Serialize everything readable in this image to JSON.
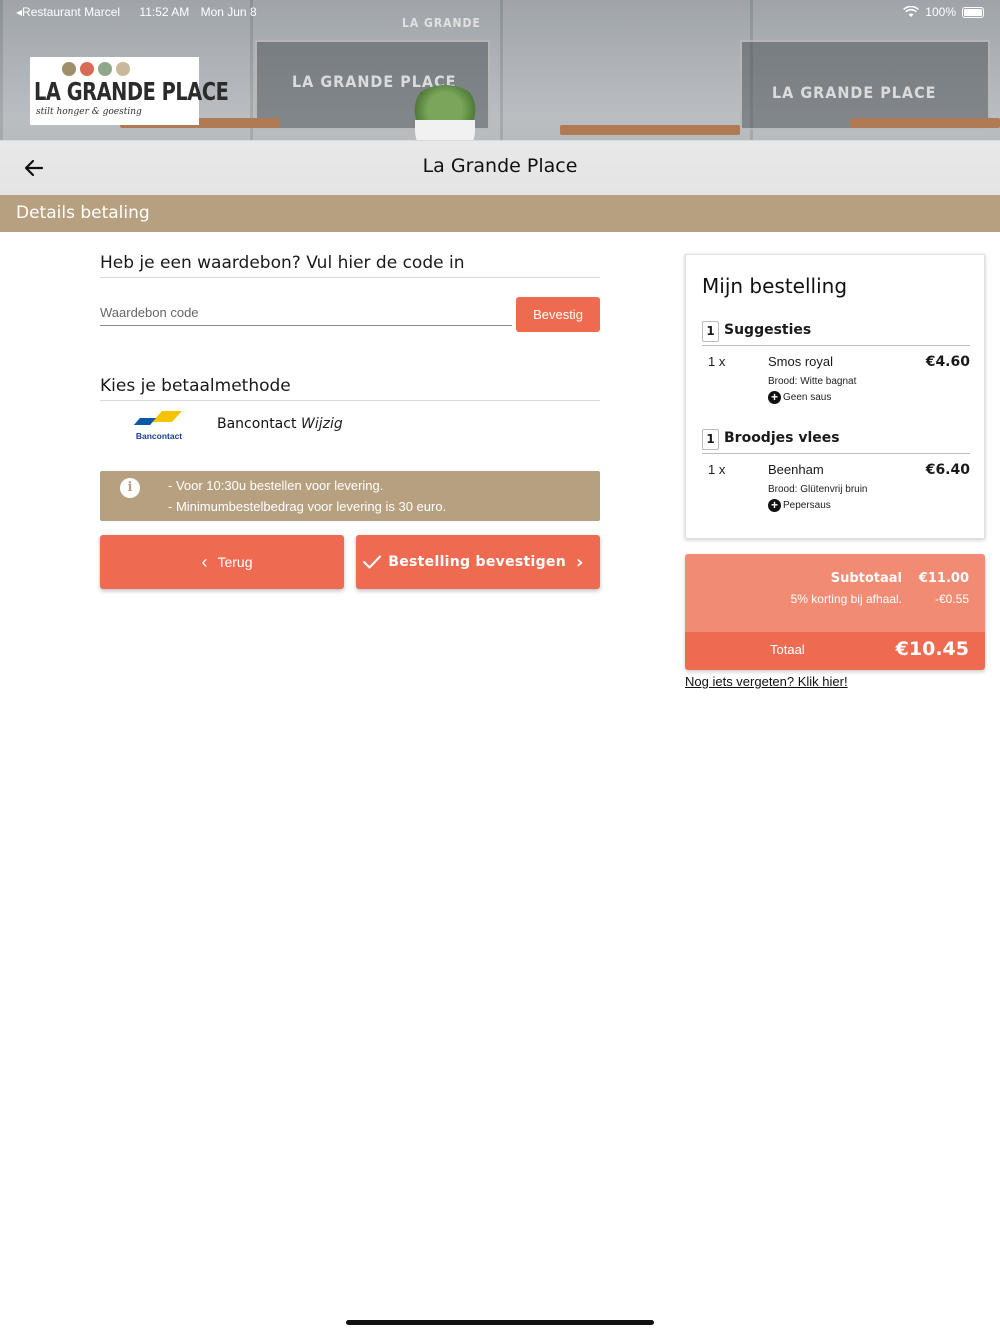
{
  "status_bar": {
    "back_app": "Restaurant Marcel",
    "time": "11:52 AM",
    "date": "Mon Jun 8",
    "battery": "100%"
  },
  "logo": {
    "brand": "LA GRANDE PLACE",
    "tagline": "stilt honger & goesting"
  },
  "header": {
    "title": "La Grande Place"
  },
  "section": {
    "title": "Details betaling"
  },
  "voucher": {
    "heading": "Heb je een waardebon? Vul hier de code in",
    "placeholder": "Waardebon code",
    "value": "",
    "confirm_label": "Bevestig"
  },
  "payment": {
    "heading": "Kies je betaalmethode",
    "logo_text": "Bancontact",
    "method": "Bancontact",
    "change_label": "Wijzig"
  },
  "info": {
    "line1": "- Voor 10:30u bestellen voor levering.",
    "line2": "- Minimumbestelbedrag voor levering is 30 euro."
  },
  "actions": {
    "back_label": "Terug",
    "order_label": "Bestelling bevestigen"
  },
  "order": {
    "heading": "Mijn bestelling",
    "categories": [
      {
        "qty": "1",
        "name": "Suggesties",
        "item": {
          "qty": "1 x",
          "name": "Smos royal",
          "price": "€4.60",
          "detail": "Brood: Witte bagnat",
          "extra": "Geen saus"
        }
      },
      {
        "qty": "1",
        "name": "Broodjes vlees",
        "item": {
          "qty": "1 x",
          "name": "Beenham",
          "price": "€6.40",
          "detail": "Brood: Glütenvrij bruin",
          "extra": "Pepersaus"
        }
      }
    ]
  },
  "totals": {
    "subtotal_label": "Subtotaal",
    "subtotal_value": "€11.00",
    "discount_label": "5% korting bij afhaal.",
    "discount_value": "-€0.55",
    "total_label": "Totaal",
    "total_value": "€10.45"
  },
  "forgot_link": "Nog iets vergeten? Klik hier!",
  "colors": {
    "accent": "#ee6b52",
    "accent_light": "#f28b74",
    "section_bar": "#b7a080"
  }
}
